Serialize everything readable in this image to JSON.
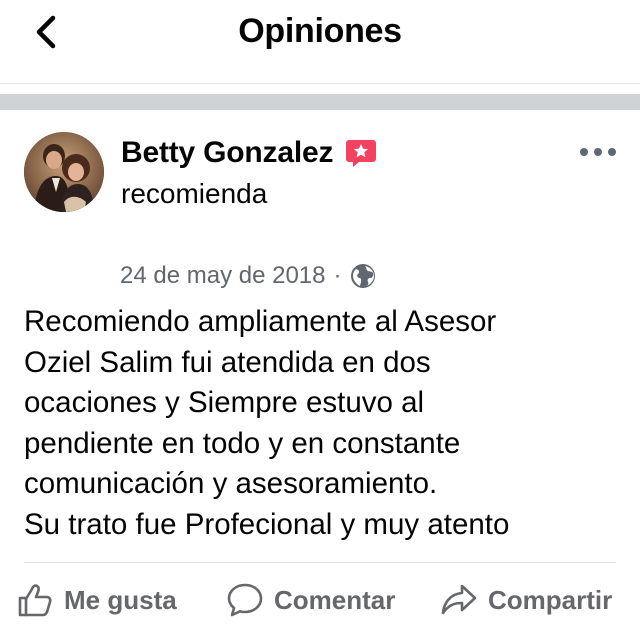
{
  "header": {
    "title": "Opiniones"
  },
  "post": {
    "author_name": "Betty Gonzalez",
    "action_label": "recomienda",
    "date": "24 de may de 2018",
    "date_separator": "·",
    "privacy_icon": "globe-icon",
    "badge_icon": "recommendation-star-icon",
    "badge_color": "#f3425f",
    "text": "Recomiendo ampliamente al Asesor\nOziel Salim fui atendida en dos\nocaciones y Siempre estuvo al\npendiente en todo y en constante\ncomunicación y asesoramiento.\nSu trato fue Profecional y muy atento"
  },
  "actions": {
    "like_label": "Me gusta",
    "comment_label": "Comentar",
    "share_label": "Compartir"
  },
  "icons": {
    "back": "chevron-left-icon",
    "more": "more-options-icon",
    "like": "thumbs-up-icon",
    "comment": "comment-bubble-icon",
    "share": "share-arrow-icon"
  },
  "colors": {
    "secondary_text": "#606770",
    "action_text": "#65676b",
    "separator": "#cfd2d6"
  }
}
